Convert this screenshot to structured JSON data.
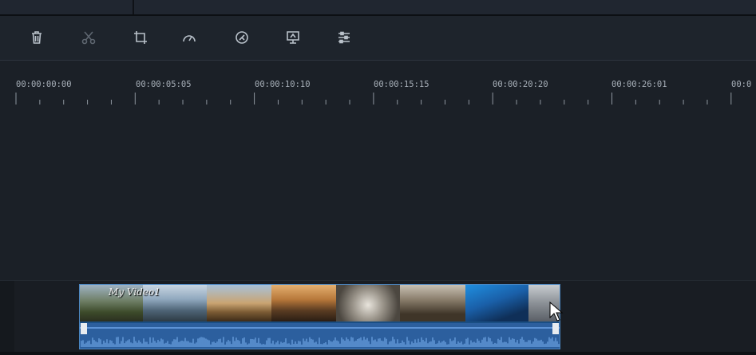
{
  "toolbar": {
    "tools": [
      {
        "name": "delete",
        "icon": "trash-icon",
        "enabled": true
      },
      {
        "name": "split",
        "icon": "scissors-icon",
        "enabled": false
      },
      {
        "name": "crop",
        "icon": "crop-icon",
        "enabled": true
      },
      {
        "name": "speed",
        "icon": "speedometer-icon",
        "enabled": true
      },
      {
        "name": "color",
        "icon": "palette-icon",
        "enabled": true
      },
      {
        "name": "green-screen",
        "icon": "presentation-icon",
        "enabled": true
      },
      {
        "name": "adjust",
        "icon": "sliders-icon",
        "enabled": true
      }
    ]
  },
  "ruler": {
    "timecodes": [
      "00:00:00:00",
      "00:00:05:05",
      "00:00:10:10",
      "00:00:15:15",
      "00:00:20:20",
      "00:00:26:01",
      "00:0"
    ]
  },
  "clip": {
    "title": "My Video1",
    "thumbnail_count": 8
  },
  "colors": {
    "background": "#1b2027",
    "toolbar": "#1e242c",
    "clip_border": "#4a86c2",
    "audio_wave": "#6fa6e6"
  }
}
